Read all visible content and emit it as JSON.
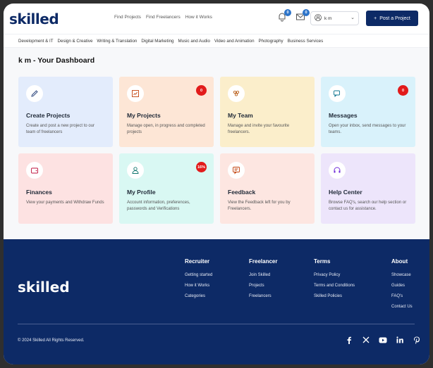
{
  "header": {
    "logo": "skilled",
    "nav": [
      "Find Projects",
      "Find Freelancers",
      "How it Works"
    ],
    "notification_count": "0",
    "message_count": "0",
    "user_name": "k m",
    "post_button": "Post a Project"
  },
  "categories": [
    "Development & IT",
    "Design & Creative",
    "Writing & Translation",
    "Digital Marketing",
    "Music and Audio",
    "Video and Animation",
    "Photography",
    "Business Services"
  ],
  "dashboard": {
    "title": "k m - Your Dashboard",
    "cards": [
      {
        "title": "Create Projects",
        "desc": "Create and post a new project to our team of freelancers",
        "badge": ""
      },
      {
        "title": "My Projects",
        "desc": "Manage open, in progress and completed projects",
        "badge": "0"
      },
      {
        "title": "My Team",
        "desc": "Manage and invite your favourite freelancers.",
        "badge": ""
      },
      {
        "title": "Messages",
        "desc": "Open your inbox, send messages to your teams.",
        "badge": "0"
      },
      {
        "title": "Finances",
        "desc": "View your payments and Withdraw Funds",
        "badge": ""
      },
      {
        "title": "My Profile",
        "desc": "Account information, preferences, passwords and Verifications",
        "badge": "16%"
      },
      {
        "title": "Feedback",
        "desc": "View the Feedback left for you by Freelancers.",
        "badge": ""
      },
      {
        "title": "Help Center",
        "desc": "Browse FAQ's, search our help section or contact us for assistance.",
        "badge": ""
      }
    ]
  },
  "colors": {
    "brand": "#0d2a66",
    "card_bgs": [
      "#e3ecfc",
      "#fde6d6",
      "#fbeecb",
      "#d9f2fb",
      "#fde2e2",
      "#d9f8f3",
      "#fde6e1",
      "#ede5fb"
    ],
    "badge_red": "#e21b1b"
  },
  "footer": {
    "logo": "skilled",
    "columns": [
      {
        "heading": "Recruiter",
        "links": [
          "Getting started",
          "How it Works",
          "Categories"
        ]
      },
      {
        "heading": "Freelancer",
        "links": [
          "Join Skilled",
          "Projects",
          "Freelancers"
        ]
      },
      {
        "heading": "Terms",
        "links": [
          "Privacy Policy",
          "Terms and Conditions",
          "Skilled Policies"
        ]
      },
      {
        "heading": "About",
        "links": [
          "Showcase",
          "Guides",
          "FAQ's",
          "Contact Us"
        ]
      }
    ],
    "copyright": "© 2024 Skilled All Rights Reserved.",
    "social_icons": [
      "facebook-icon",
      "x-icon",
      "youtube-icon",
      "linkedin-icon",
      "pinterest-icon"
    ]
  }
}
